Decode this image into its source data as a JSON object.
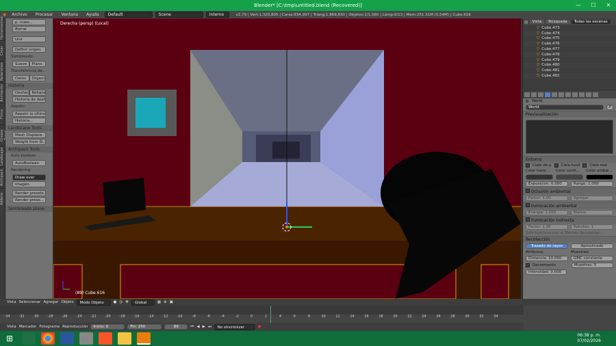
{
  "window": {
    "title": "Blender* [C:\\tmp\\untitled.blend (Recovered)]",
    "minimize": "—",
    "maximize": "☐",
    "close": "✕"
  },
  "menubar": {
    "items": [
      "Archivo",
      "Procesar",
      "Ventana",
      "Ayuda"
    ],
    "layout": "Default",
    "scene": "Scene",
    "engine": "Interno",
    "stats": "v2.79 | Vert:1,320,805 | Caras:934,997 | Triáng:1,869,830 | Objetos:1/1,560 | Lámp:0/13 | Mem:251.31M (5.54M) | Cube.616"
  },
  "left_tabs": [
    "Herramientas",
    "Crear",
    "Relaciones",
    "Animación",
    "Física",
    "Grease Pencil",
    "Landscape",
    "Archipack",
    "Addons"
  ],
  "toolshelf": {
    "top_btn": "p. nuev...",
    "del": "Borrar",
    "join": "Unir",
    "origin": "Definir origen",
    "smooth_label": "Sombreado:",
    "smooth": "Suave",
    "flat": "Plano",
    "transfer_label": "Transferencia de...",
    "data": "Datos",
    "org": "Organiza",
    "history_hdr": "Historia",
    "undo": "Deshacer",
    "redo": "Rehacer",
    "hist": "Historia de deshacer",
    "repeat_label": "Repetir:",
    "repeat": "Repetir lo último",
    "history": "Historia...",
    "landscape_hdr": "Landscape Tools",
    "mesh_displace": "Mesh Displace",
    "weight": "Weight from Sl...",
    "archipack_hdr": "Archipack Tools",
    "autob": "Auto boolean",
    "autob2": "AutoBoolean",
    "rendering": "Rendering",
    "draw_over": "Draw over",
    "image": "Imagen",
    "render_presets": "Render presets...",
    "render_pres": "Render prese...",
    "shading": "Sombreado plano"
  },
  "viewport": {
    "label": "Derecha (persp) (Local)",
    "object": "(89) Cube.616"
  },
  "outliner": {
    "tabs": [
      "Vista",
      "Búsqueda",
      "Todas las escenas"
    ],
    "rows": [
      "Cube.473",
      "Cube.474",
      "Cube.475",
      "Cube.476",
      "Cube.477",
      "Cube.478",
      "Cube.479",
      "Cube.480",
      "Cube.481",
      "Cube.482"
    ]
  },
  "properties": {
    "crumb": "World",
    "world_field": "World",
    "f_btn": "F",
    "preview": "Previsualización",
    "ambient": "Entorno",
    "sky_opts": [
      "Cielo de p",
      "Cielo fund",
      "Cielo real"
    ],
    "colors": [
      "Color horiz...",
      "Color cenit...",
      "Color ambie..."
    ],
    "exposure": "Exposición: 0.000",
    "range": "Rango: 1.000",
    "ao": "Oclusión ambiental",
    "ao_factor": "Factor: 1.00",
    "ao_mode": "Agregar",
    "env": "Iluminación ambiental",
    "env_energy": "Energía: 1.000",
    "env_mode": "Blanco",
    "indirect": "Iluminación indirecta",
    "ind_factor": "Factor: 1.00",
    "ind_bounces": "Rebotes: 1",
    "ind_note": "Sólo funciona con el Método Recolectar...",
    "gather": "Recolección",
    "gather_raytrace": "Trazado de rayos",
    "gather_approx": "Aproximado",
    "attrib": "Atributos:",
    "sampling": "Muestreo:",
    "dist": "Distancia: 10.000",
    "qmc": "QMC constante",
    "falloff": "Decremento",
    "samples": "Muestras: 5",
    "strength": "Intensidad: 0.000"
  },
  "view_header": {
    "items": [
      "Vista",
      "Seleccionar",
      "Agregar",
      "Objeto"
    ],
    "mode": "Modo Objeto",
    "pivot": "Global"
  },
  "timeline": {
    "ruler": [
      "-34",
      "-32",
      "-30",
      "-28",
      "-26",
      "-24",
      "-22",
      "-20",
      "-18",
      "-16",
      "-14",
      "-12",
      "-10",
      "-8",
      "-6",
      "-4",
      "-2",
      "0",
      "2",
      "4",
      "6",
      "8",
      "10",
      "12",
      "14",
      "16",
      "18",
      "20",
      "22",
      "24",
      "26",
      "28",
      "30",
      "32",
      "34"
    ],
    "menus": [
      "Vista",
      "Marcador",
      "Fotograma",
      "Reproducción"
    ],
    "start": "Inicio: 0",
    "end": "Fin: 250",
    "current": "89",
    "sync": "No sincronizar"
  },
  "taskbar": {
    "time": "06:38 p. m.",
    "date": "07/02/2026"
  }
}
